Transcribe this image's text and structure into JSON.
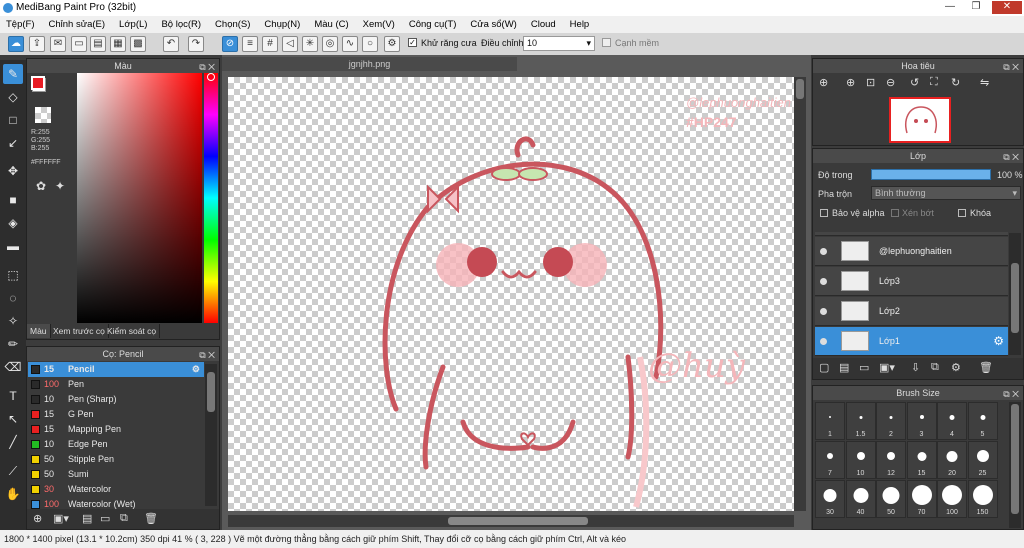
{
  "window": {
    "title": "MediBang Paint Pro (32bit)",
    "min": "—",
    "restore": "❐",
    "close": "✕"
  },
  "menu": [
    "Tệp(F)",
    "Chỉnh sửa(E)",
    "Lớp(L)",
    "Bộ lọc(R)",
    "Chọn(S)",
    "Chụp(N)",
    "Màu (C)",
    "Xem(V)",
    "Công cụ(T)",
    "Cửa sổ(W)",
    "Cloud",
    "Help"
  ],
  "toolbar": {
    "antialias_label": "Khử răng cưa",
    "correction_label": "Điều chỉnh",
    "correction_value": "10",
    "edge_label": "Cạnh mềm"
  },
  "color_panel": {
    "title": "Màu",
    "r": "R:255",
    "g": "G:255",
    "b": "B:255",
    "hex": "#FFFFFF",
    "tabs": [
      "Màu",
      "Xem trước cọ",
      "Kiểm soát cọ"
    ]
  },
  "brush_panel": {
    "title": "Cọ: Pencil",
    "items": [
      {
        "size": "15",
        "name": "Pencil",
        "color": "#2a2a2a"
      },
      {
        "size": "100",
        "name": "Pen",
        "color": "#2a2a2a"
      },
      {
        "size": "10",
        "name": "Pen (Sharp)",
        "color": "#2a2a2a"
      },
      {
        "size": "15",
        "name": "G Pen",
        "color": "#e82020"
      },
      {
        "size": "15",
        "name": "Mapping Pen",
        "color": "#e82020"
      },
      {
        "size": "10",
        "name": "Edge Pen",
        "color": "#22bb22"
      },
      {
        "size": "50",
        "name": "Stipple Pen",
        "color": "#f0d000"
      },
      {
        "size": "50",
        "name": "Sumi",
        "color": "#f0d000"
      },
      {
        "size": "30",
        "name": "Watercolor",
        "color": "#f0d000"
      },
      {
        "size": "100",
        "name": "Watercolor (Wet)",
        "color": "#3a8fd8"
      }
    ]
  },
  "canvas": {
    "tab": "jgnjhh.png",
    "watermark_top": "@lephuonghaitien",
    "watermark_tag": "#HP247",
    "signature": "@huỳ"
  },
  "navigator": {
    "title": "Hoa tiêu"
  },
  "layers": {
    "title": "Lớp",
    "opacity_label": "Độ trong",
    "opacity_value": "100 %",
    "blend_label": "Pha trộn",
    "blend_value": "Bình thường",
    "protect_alpha": "Bảo vệ alpha",
    "clipping": "Xén bớt",
    "lock": "Khóa",
    "rows": [
      {
        "name": "@lephuonghaitien"
      },
      {
        "name": "Lớp3"
      },
      {
        "name": "Lớp2"
      },
      {
        "name": "Lớp1"
      }
    ]
  },
  "brush_size": {
    "title": "Brush Size",
    "sizes": [
      "1",
      "1.5",
      "2",
      "3",
      "4",
      "5",
      "7",
      "10",
      "12",
      "15",
      "20",
      "25",
      "30",
      "40",
      "50",
      "70",
      "100",
      "150"
    ]
  },
  "status": {
    "text": "1800 * 1400 pixel  (13.1 * 10.2cm)  350 dpi  41 %  ( 3, 228 )  Vẽ một đường thẳng bằng cách giữ phím Shift, Thay đổi cỡ cọ bằng cách giữ phím Ctrl, Alt và kéo"
  }
}
